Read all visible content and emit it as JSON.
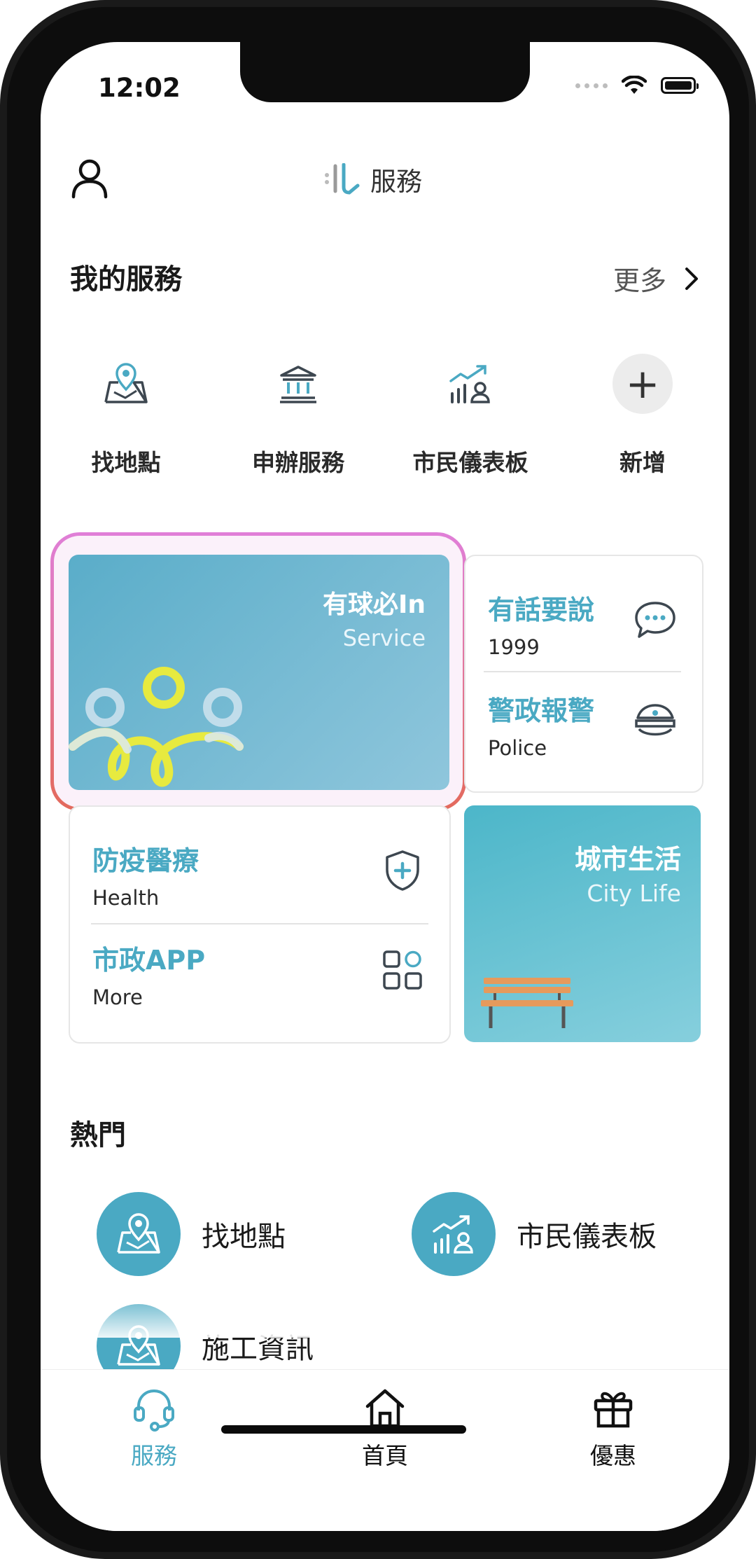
{
  "status": {
    "time": "12:02"
  },
  "header": {
    "title": "服務"
  },
  "my_services": {
    "title": "我的服務",
    "more": "更多",
    "items": [
      {
        "label": "找地點",
        "icon": "map-pin-icon"
      },
      {
        "label": "申辦服務",
        "icon": "government-building-icon"
      },
      {
        "label": "市民儀表板",
        "icon": "dashboard-chart-icon"
      },
      {
        "label": "新增",
        "icon": "plus-icon"
      }
    ]
  },
  "cards": {
    "ball": {
      "title": "有球必In",
      "subtitle": "Service"
    },
    "talk": {
      "title": "有話要說",
      "subtitle": "1999"
    },
    "police": {
      "title": "警政報警",
      "subtitle": "Police"
    },
    "health": {
      "title": "防疫醫療",
      "subtitle": "Health"
    },
    "app": {
      "title": "市政APP",
      "subtitle": "More"
    },
    "city": {
      "title": "城市生活",
      "subtitle": "City Life"
    }
  },
  "hot": {
    "title": "熱門",
    "items": [
      {
        "label": "找地點",
        "icon": "map-pin-icon"
      },
      {
        "label": "市民儀表板",
        "icon": "dashboard-chart-icon"
      },
      {
        "label": "施工資訊",
        "icon": "map-pin-icon"
      }
    ]
  },
  "tabs": [
    {
      "label": "服務",
      "icon": "headset-icon",
      "active": true
    },
    {
      "label": "首頁",
      "icon": "home-icon",
      "active": false
    },
    {
      "label": "優惠",
      "icon": "gift-icon",
      "active": false
    }
  ],
  "colors": {
    "accent": "#4aa9c3",
    "text": "#1a1a1a",
    "highlight_border": "#e07fd8"
  }
}
